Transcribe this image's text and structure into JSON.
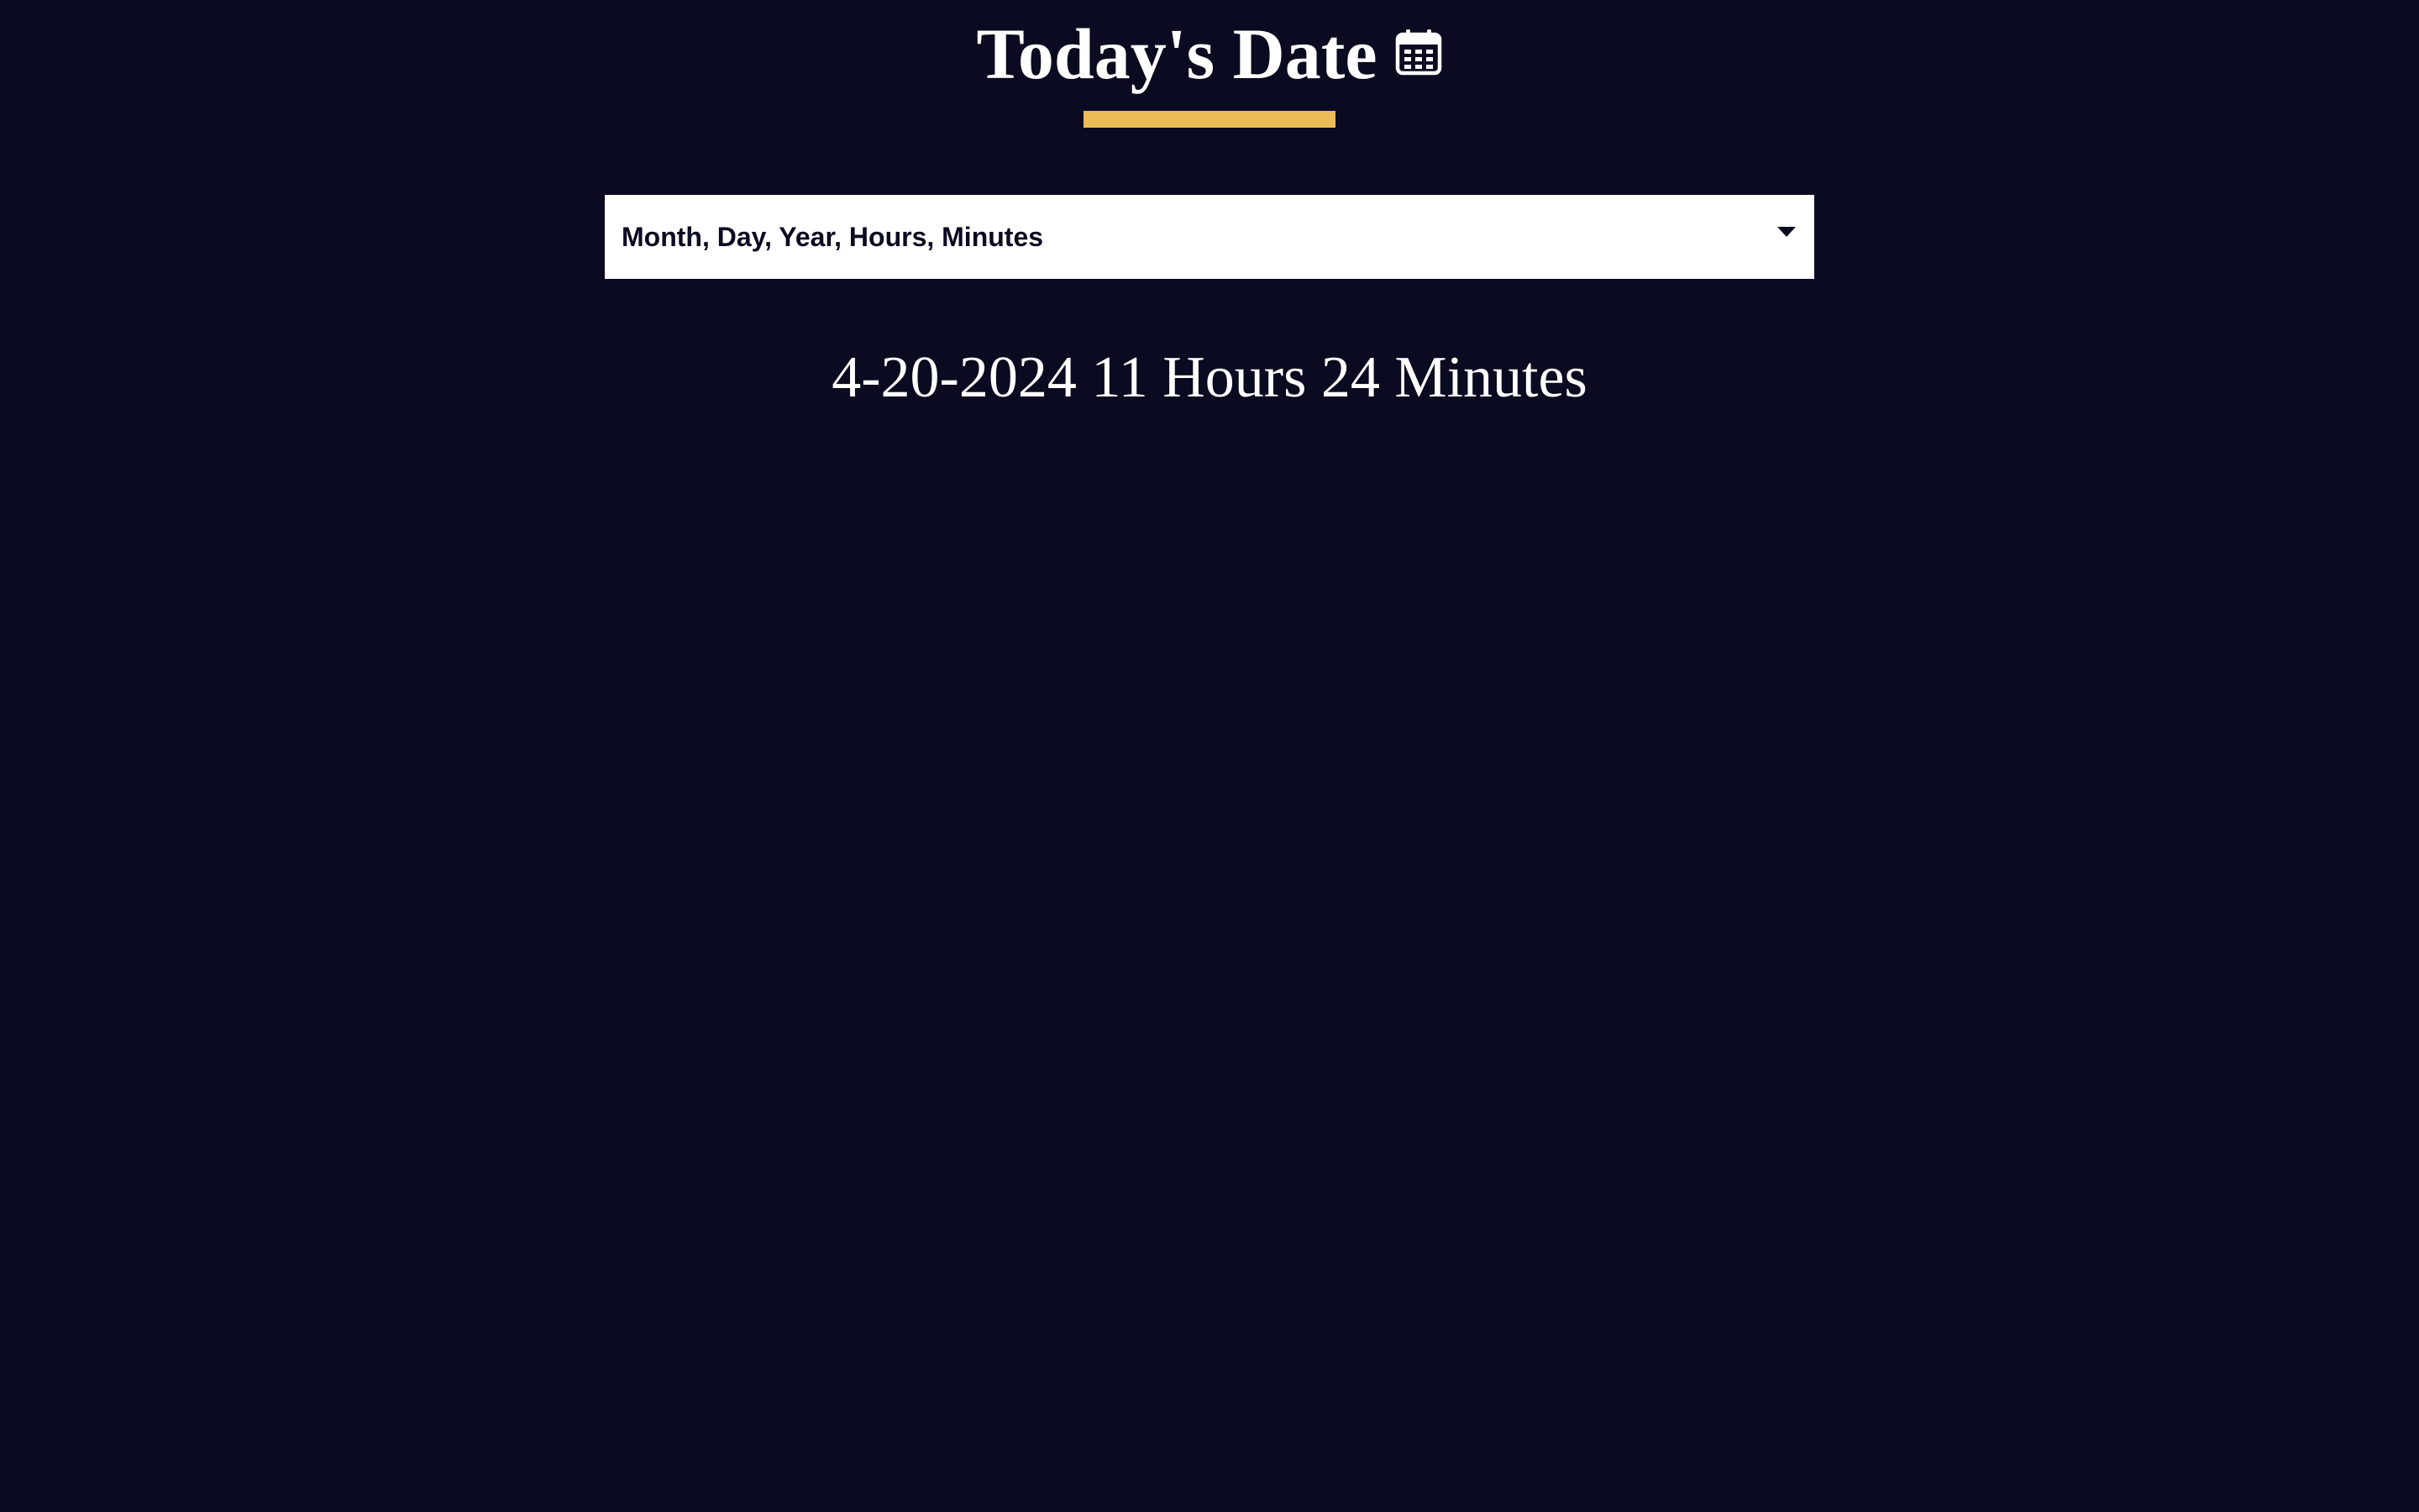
{
  "header": {
    "title": "Today's Date",
    "icon": "calendar-icon"
  },
  "colors": {
    "background": "#0a0a20",
    "accent": "#ecbc56",
    "text": "#ffffff"
  },
  "format_select": {
    "selected": "Month, Day, Year, Hours, Minutes",
    "icon": "chevron-down-icon"
  },
  "output": {
    "text": "4-20-2024 11 Hours 24 Minutes"
  }
}
